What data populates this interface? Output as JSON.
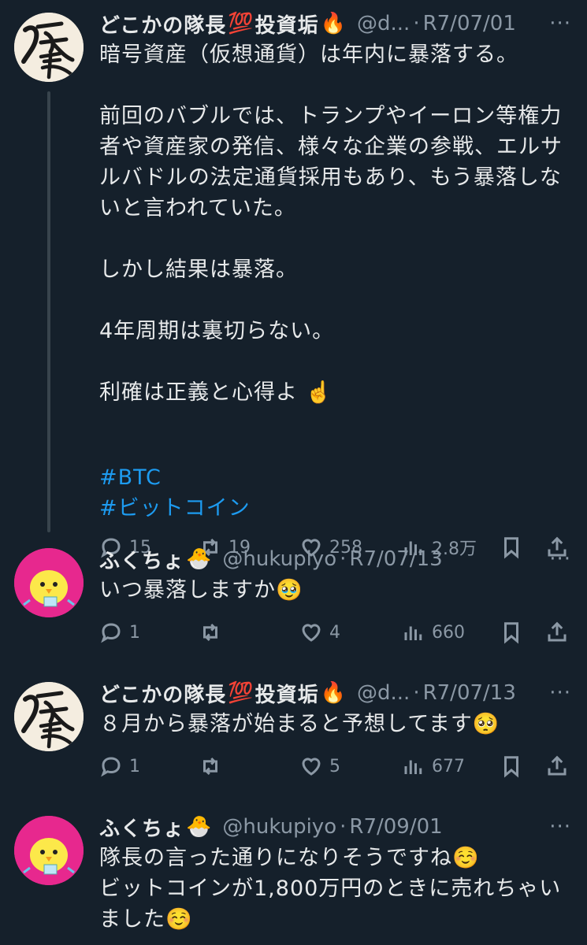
{
  "tweets": [
    {
      "name": "どこかの隊長",
      "emoji1": "💯",
      "name2": "投資垢",
      "emoji2": "🔥",
      "handle": "@d...",
      "sep": "·",
      "date": "R7/07/01",
      "more": "···",
      "body": "暗号資産（仮想通貨）は年内に暴落する。\n\n前回のバブルでは、トランプやイーロン等権力者や資産家の発信、様々な企業の参戦、エルサルバドルの法定通貨採用もあり、もう暴落しないと言われていた。\n\nしかし結果は暴落。\n\n4年周期は裏切らない。\n\n利確は正義と心得よ ☝️",
      "hashtags": [
        "#BTC",
        "#ビットコイン"
      ],
      "replies": "15",
      "retweets": "19",
      "likes": "258",
      "views": "2.8万"
    },
    {
      "name": "ふくちょ",
      "emoji1": "🐣",
      "handle": "@hukupiyo",
      "sep": "·",
      "date": "R7/07/13",
      "more": "···",
      "body": "いつ暴落しますか🥹",
      "replies": "1",
      "retweets": "",
      "likes": "4",
      "views": "660"
    },
    {
      "name": "どこかの隊長",
      "emoji1": "💯",
      "name2": "投資垢",
      "emoji2": "🔥",
      "handle": "@d...",
      "sep": "·",
      "date": "R7/07/13",
      "more": "···",
      "body": "８月から暴落が始まると予想してます🥺",
      "replies": "1",
      "retweets": "",
      "likes": "5",
      "views": "677"
    },
    {
      "name": "ふくちょ",
      "emoji1": "🐣",
      "handle": "@hukupiyo",
      "sep": "·",
      "date": "R7/09/01",
      "more": "···",
      "body": "隊長の言った通りになりそうですね☺️\nビットコインが1,800万円のときに売れちゃいました☺️"
    }
  ],
  "avatar_text": {
    "kanji": "隊長"
  },
  "colors": {
    "bg": "#15202b",
    "text": "#e7e9ea",
    "muted": "#8b98a5",
    "link": "#1d9bf0",
    "chick_bg": "#e7288e"
  }
}
